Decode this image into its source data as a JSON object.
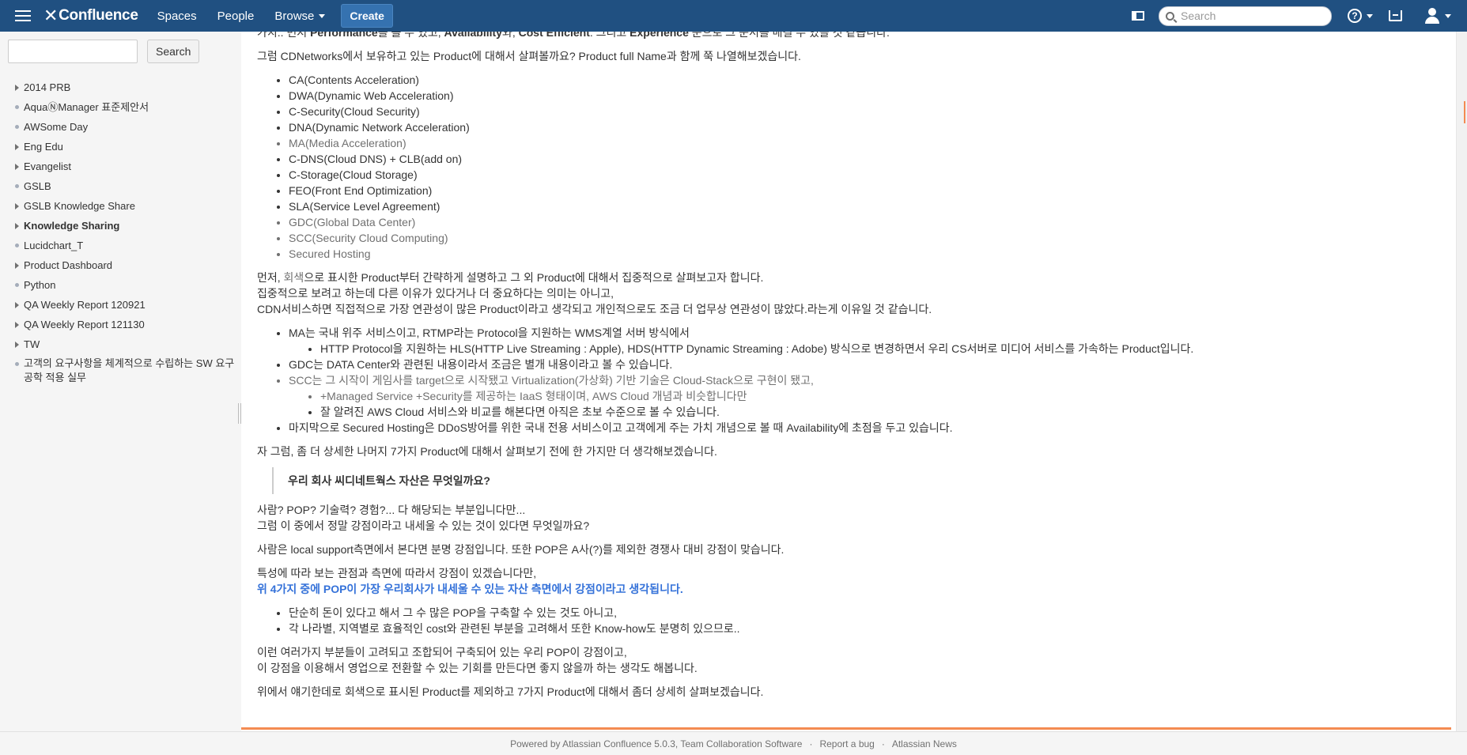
{
  "header": {
    "logo": "Confluence",
    "nav": {
      "spaces": "Spaces",
      "people": "People",
      "browse": "Browse"
    },
    "create": "Create",
    "search_placeholder": "Search"
  },
  "sidebar": {
    "search_button": "Search",
    "items": [
      {
        "label": "2014 PRB",
        "type": "arrow"
      },
      {
        "label": "AquaⓃManager 표준제안서",
        "type": "dot"
      },
      {
        "label": "AWSome Day",
        "type": "dot"
      },
      {
        "label": "Eng Edu",
        "type": "arrow"
      },
      {
        "label": "Evangelist",
        "type": "arrow"
      },
      {
        "label": "GSLB",
        "type": "dot"
      },
      {
        "label": "GSLB Knowledge Share",
        "type": "arrow"
      },
      {
        "label": "Knowledge Sharing",
        "type": "arrow"
      },
      {
        "label": "Lucidchart_T",
        "type": "dot"
      },
      {
        "label": "Product Dashboard",
        "type": "arrow"
      },
      {
        "label": "Python",
        "type": "dot"
      },
      {
        "label": "QA Weekly Report 120921",
        "type": "arrow"
      },
      {
        "label": "QA Weekly Report 121130",
        "type": "arrow"
      },
      {
        "label": "TW",
        "type": "arrow"
      },
      {
        "label": "고객의 요구사항을 체계적으로 수립하는 SW 요구공학 적용 실무",
        "type": "dot"
      }
    ]
  },
  "content": {
    "top_partial": {
      "pre": "가치.. 먼저 ",
      "b1": "Performance",
      "mid1": "를 볼 수 있고, ",
      "b2": "Availability",
      "mid2": "와, ",
      "b3": "Cost Efficient",
      "mid3": ". 그리고 ",
      "b4": "Experience",
      "post": " 순으로 그 순서를 매길 수 있을 것 같습니다."
    },
    "intro": "그럼 CDNetworks에서 보유하고 있는 Product에 대해서 살펴볼까요? Product full Name과 함께 쭉 나열해보겠습니다.",
    "products": [
      "CA(Contents Acceleration)",
      "DWA(Dynamic Web Acceleration)",
      "C-Security(Cloud Security)",
      "DNA(Dynamic Network Acceleration)",
      "MA(Media Acceleration)",
      "C-DNS(Cloud DNS) + CLB(add on)",
      "C-Storage(Cloud Storage)",
      "FEO(Front End Optimization)",
      "SLA(Service Level Agreement)",
      "GDC(Global Data Center)",
      "SCC(Security Cloud Computing)",
      "Secured Hosting"
    ],
    "para2": {
      "pre": "먼저, ",
      "grey": "회색",
      "post": "으로 표시한 Product부터 간략하게 설명하고 그 외 Product에 대해서 집중적으로 살펴보고자 합니다.",
      "line2": "집중적으로 보려고 하는데 다른 이유가 있다거나 더 중요하다는 의미는 아니고,",
      "line3": "CDN서비스하면 직접적으로 가장 연관성이 많은 Product이라고 생각되고 개인적으로도 조금 더 업무상 연관성이 많았다.라는게 이유일 것 같습니다."
    },
    "details": {
      "ma": "MA는 국내 위주 서비스이고, RTMP라는 Protocol을 지원하는 WMS계열 서버 방식에서",
      "ma_sub": "HTTP Protocol을 지원하는 HLS(HTTP Live Streaming : Apple), HDS(HTTP Dynamic Streaming : Adobe) 방식으로 변경하면서 우리 CS서버로 미디어 서비스를 가속하는 Product입니다.",
      "gdc": "GDC는 DATA Center와 관련된 내용이라서 조금은 별개 내용이라고 볼 수 있습니다.",
      "scc": "SCC는 그 시작이 게임사를 target으로 시작됐고 Virtualization(가상화) 기반 기술은 Cloud-Stack으로 구현이 됐고,",
      "scc_sub1": "+Managed Service +Security를 제공하는 IaaS 형태이며, AWS Cloud 개념과 비슷합니다만",
      "scc_sub2": "잘 알려진 AWS Cloud 서비스와 비교를 해본다면 아직은 초보 수준으로 볼 수 있습니다.",
      "sh": "마지막으로 Secured Hosting은 DDoS방어를 위한 국내 전용 서비스이고 고객에게 주는 가치 개념으로 볼 때 Availability에 초점을 두고 있습니다."
    },
    "para3": "자 그럼, 좀 더 상세한 나머지 7가지 Product에 대해서 살펴보기 전에 한 가지만 더 생각해보겠습니다.",
    "quote": "우리 회사 씨디네트웍스 자산은 무엇일까요?",
    "para4": {
      "line1": "사람? POP? 기술력? 경험?... 다 해당되는 부분입니다만...",
      "line2": "그럼 이 중에서 정말 강점이라고 내세울 수 있는 것이 있다면 무엇일까요?"
    },
    "para5": "사람은 local support측면에서 본다면 분명 강점입니다. 또한 POP은 A사(?)를 제외한 경쟁사 대비 강점이 맞습니다.",
    "para6": {
      "line1": "특성에 따라 보는 관점과 측면에 따라서 강점이 있겠습니다만,",
      "line2": "위 4가지 중에 POP이 가장 우리회사가 내세울 수 있는 자산 측면에서 강점이라고 생각됩니다."
    },
    "bullets2": [
      "단순히 돈이 있다고 해서 그 수 많은 POP을 구축할 수 있는 것도 아니고,",
      "각 나라별, 지역별로 효율적인 cost와 관련된 부분을 고려해서 또한 Know-how도 분명히 있으므로.."
    ],
    "para7": {
      "line1": "이런 여러가지 부분들이 고려되고 조합되어 구축되어 있는 우리 POP이 강점이고,",
      "line2": "이 강점을 이용해서 영업으로 전환할 수 있는 기회를 만든다면 좋지 않을까 하는 생각도 해봅니다."
    },
    "para8": "위에서 얘기한데로 회색으로 표시된 Product를 제외하고 7가지 Product에 대해서 좀더 상세히 살펴보겠습니다."
  },
  "footer": {
    "powered": "Powered by Atlassian Confluence 5.0.3, Team Collaboration Software",
    "report_bug": "Report a bug",
    "news": "Atlassian News"
  },
  "colors": {
    "header_bg": "#205081",
    "grey_text": "#707070",
    "accent_blue": "#3572d9",
    "orange_bar": "#f48b52"
  }
}
